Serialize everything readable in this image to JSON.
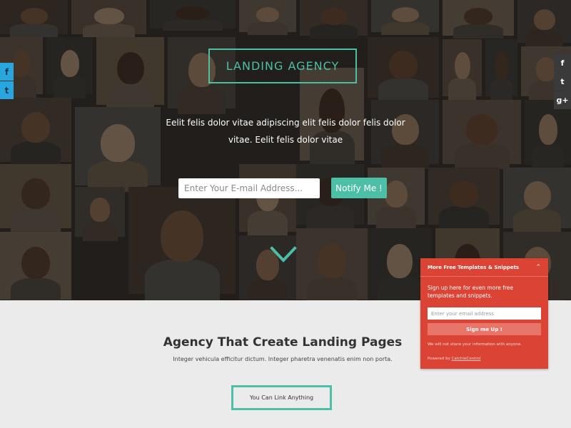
{
  "hero": {
    "logo_text": "LANDING AGENCY",
    "tagline": "Eelit felis dolor vitae adipiscing elit felis dolor felis dolor vitae. Eelit felis dolor vitae",
    "email_placeholder": "Enter Your E-mail Address...",
    "notify_label": "Notify Me !",
    "chevron_icon": "chevron-down-icon"
  },
  "social_left": [
    {
      "icon": "facebook-icon",
      "glyph": "f"
    },
    {
      "icon": "twitter-icon",
      "glyph": "t"
    }
  ],
  "social_right": [
    {
      "icon": "facebook-icon",
      "glyph": "f"
    },
    {
      "icon": "twitter-icon",
      "glyph": "t"
    },
    {
      "icon": "google-plus-icon",
      "glyph": "g+"
    }
  ],
  "section": {
    "title": "Agency That Create Landing Pages",
    "subtitle": "Integer vehicula efficitur dictum. Integer pharetra venenatis enim non porta.",
    "link_button": "You Can Link Anything"
  },
  "widget": {
    "title": "More Free Templates & Snippets",
    "toggle_glyph": "⌃",
    "description": "Sign up here for even more free templates and snippets.",
    "email_placeholder": "Enter your email address",
    "signup_label": "Sign me Up !",
    "privacy_note": "We will not share your information with anyone.",
    "powered_prefix": "Powered by",
    "powered_link": "CatchieControl"
  },
  "colors": {
    "accent": "#4cbfa6",
    "widget_red": "#db4335",
    "social_blue": "#2aa6df",
    "social_dark": "#3a3a3a"
  }
}
